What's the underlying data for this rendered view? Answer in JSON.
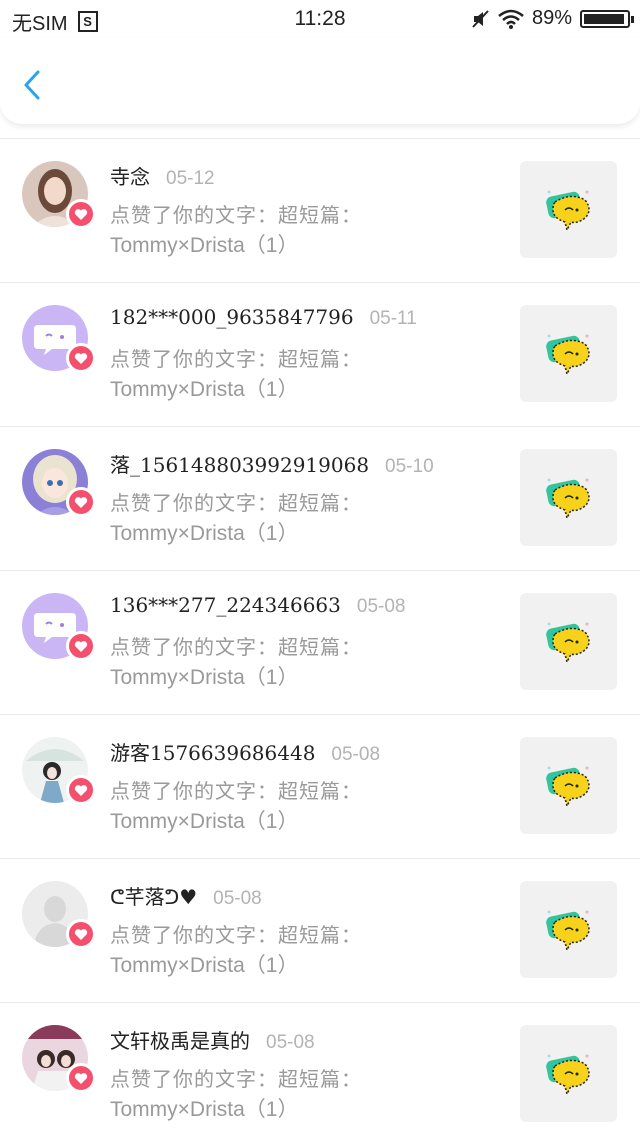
{
  "status_bar": {
    "carrier": "无SIM",
    "sim_icon_letter": "S",
    "time": "11:28",
    "battery": "89%",
    "battery_level": 0.89
  },
  "nav": {
    "back_icon": "chevron-left-icon"
  },
  "notifications": [
    {
      "username": "寺念",
      "date": "05-12",
      "action_text": "点赞了你的文字：超短篇：",
      "content_title": "Tommy×Drista（1）",
      "avatar": "photo-girl"
    },
    {
      "username": "182***000_9635847796",
      "date": "05-11",
      "action_text": "点赞了你的文字：超短篇：",
      "content_title": "Tommy×Drista（1）",
      "avatar": "default-chat-bubble"
    },
    {
      "username": "落_156148803992919068",
      "date": "05-10",
      "action_text": "点赞了你的文字：超短篇：",
      "content_title": "Tommy×Drista（1）",
      "avatar": "anime-doll"
    },
    {
      "username": "136***277_224346663",
      "date": "05-08",
      "action_text": "点赞了你的文字：超短篇：",
      "content_title": "Tommy×Drista（1）",
      "avatar": "default-chat-bubble"
    },
    {
      "username": "游客1576639686448",
      "date": "05-08",
      "action_text": "点赞了你的文字：超短篇：",
      "content_title": "Tommy×Drista（1）",
      "avatar": "illustration-umbrella"
    },
    {
      "username": "ᕦ芊落ᕤ♥",
      "date": "05-08",
      "action_text": "点赞了你的文字：超短篇：",
      "content_title": "Tommy×Drista（1）",
      "avatar": "default-grey-person"
    },
    {
      "username": "文轩极禹是真的",
      "date": "05-08",
      "action_text": "点赞了你的文字：超短篇：",
      "content_title": "Tommy×Drista（1）",
      "avatar": "photo-couple"
    }
  ],
  "colors": {
    "accent_blue": "#2aa3f0",
    "heart_badge": "#f4506e",
    "thumb_bubble_yellow": "#f7d21b",
    "thumb_bubble_green": "#33c49b",
    "default_avatar_purple": "#cbb6f5"
  }
}
